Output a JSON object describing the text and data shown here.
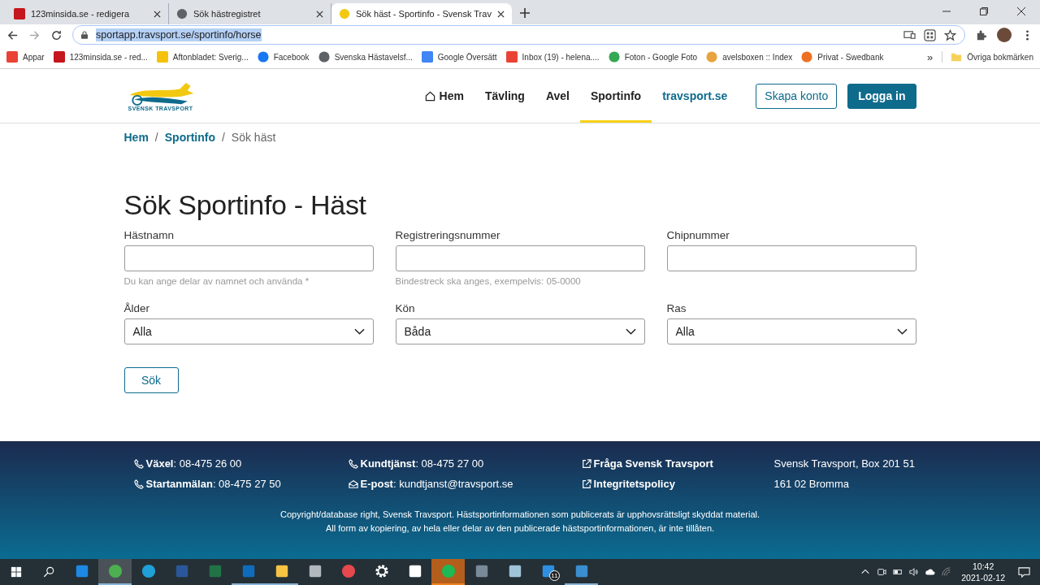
{
  "browser": {
    "tabs": [
      {
        "title": "123minsida.se - redigera",
        "selected": false
      },
      {
        "title": "Sök hästregistret",
        "selected": false
      },
      {
        "title": "Sök häst - Sportinfo - Svensk Trav",
        "selected": true
      }
    ],
    "url": "sportapp.travsport.se/sportinfo/horse",
    "bookmarks": [
      {
        "label": "Appar"
      },
      {
        "label": "123minsida.se - red..."
      },
      {
        "label": "Aftonbladet: Sverig..."
      },
      {
        "label": "Facebook"
      },
      {
        "label": "Svenska Hästavelsf..."
      },
      {
        "label": "Google Översätt"
      },
      {
        "label": "Inbox (19) - helena...."
      },
      {
        "label": "Foton - Google Foto"
      },
      {
        "label": "avelsboxen :: Index"
      },
      {
        "label": "Privat - Swedbank"
      }
    ],
    "more": "»",
    "other_bookmarks": "Övriga bokmärken"
  },
  "site": {
    "logo_text": "SVENSK TRAVSPORT",
    "nav": [
      {
        "label": "Hem",
        "kind": "home",
        "selected": false
      },
      {
        "label": "Tävling",
        "kind": "plain",
        "selected": false
      },
      {
        "label": "Avel",
        "kind": "plain",
        "selected": false
      },
      {
        "label": "Sportinfo",
        "kind": "plain",
        "selected": true
      },
      {
        "label": "travsport.se",
        "kind": "external",
        "selected": false
      }
    ],
    "create_account": "Skapa konto",
    "login": "Logga in",
    "breadcrumb": [
      {
        "label": "Hem",
        "link": true
      },
      {
        "label": "Sportinfo",
        "link": true
      },
      {
        "label": "Sök häst",
        "link": false
      }
    ],
    "breadcrumb_separator": "/",
    "heading": "Sök Sportinfo - Häst",
    "fields": [
      {
        "label": "Hästnamn",
        "kind": "text",
        "hint": "Du kan ange delar av namnet och använda *"
      },
      {
        "label": "Registreringsnummer",
        "kind": "text",
        "hint": "Bindestreck ska anges, exempelvis: 05-0000"
      },
      {
        "label": "Chipnummer",
        "kind": "text"
      },
      {
        "label": "Ålder",
        "kind": "select",
        "value": "Alla"
      },
      {
        "label": "Kön",
        "kind": "select",
        "value": "Båda"
      },
      {
        "label": "Ras",
        "kind": "select",
        "value": "Alla"
      }
    ],
    "search_button": "Sök"
  },
  "footer": {
    "columns": [
      [
        {
          "kind": "phone",
          "value": "**Växel**: 08-475 26 00"
        },
        {
          "kind": "phone",
          "value": "**Startanmälan**: 08-475 27 50"
        }
      ],
      [
        {
          "kind": "phone",
          "value": "**Kundtjänst**: 08-475 27 00"
        },
        {
          "kind": "mail",
          "value": "**E-post**: kundtjanst@travsport.se"
        }
      ],
      [
        {
          "kind": "link",
          "label": "Fråga Svensk Travsport"
        },
        {
          "kind": "link",
          "label": "Integritetspolicy"
        }
      ],
      [
        {
          "kind": "text",
          "value": "Svensk Travsport, Box 201 51"
        },
        {
          "kind": "text",
          "value": "161 02 Bromma"
        }
      ]
    ],
    "copyright": "Copyright/database right, Svensk Travsport. Hästsportinformationen som publicerats är upphovsrättsligt skyddat material. All form av kopiering, av hela eller delar av den publicerade hästsportinformationen, är inte tillåten."
  },
  "taskbar": {
    "apps": [
      {
        "kind": "mail",
        "selected": false,
        "running": false
      },
      {
        "kind": "chrome",
        "selected": true,
        "running": true
      },
      {
        "kind": "edge",
        "selected": false,
        "running": false
      },
      {
        "kind": "word",
        "selected": false,
        "running": false
      },
      {
        "kind": "excel",
        "selected": false,
        "running": false
      },
      {
        "kind": "outlook",
        "selected": false,
        "running": true
      },
      {
        "kind": "folder",
        "selected": false,
        "running": true
      },
      {
        "kind": "printer",
        "selected": false,
        "running": false
      },
      {
        "kind": "snip",
        "selected": false,
        "running": false
      },
      {
        "kind": "settings",
        "selected": false,
        "running": false
      },
      {
        "kind": "terminal",
        "selected": false,
        "running": false
      },
      {
        "kind": "spotify",
        "selected": true,
        "running": true
      },
      {
        "kind": "calculator",
        "selected": false,
        "running": false
      },
      {
        "kind": "notepad",
        "selected": false,
        "running": false
      },
      {
        "kind": "phone",
        "selected": false,
        "running": false,
        "badge": "11"
      },
      {
        "kind": "photos",
        "selected": false,
        "running": true
      }
    ],
    "time": "10:42",
    "date": "2021-02-12"
  }
}
